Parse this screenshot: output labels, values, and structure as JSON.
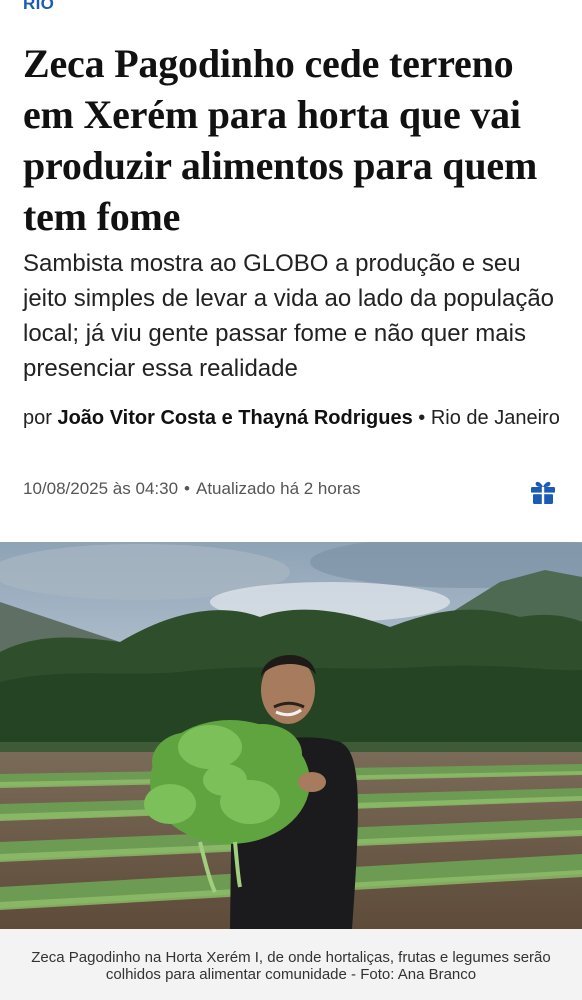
{
  "section_label": "RIO",
  "headline": "Zeca Pagodinho cede terreno em Xerém para horta que vai produzir alimentos para quem tem fome",
  "subtitle": "Sambista mostra ao GLOBO a produção e seu jeito simples de levar a vida ao lado da população local; já viu gente passar fome e não quer mais presenciar essa realidade",
  "byline": {
    "prefix": "por",
    "authors": "João Vitor Costa e Thayná Rodrigues",
    "location": "• Rio de Janeiro"
  },
  "meta": {
    "published": "10/08/2025 às 04:30",
    "separator": "•",
    "updated_label": "Atualizado",
    "updated_value": "há 2 horas"
  },
  "icons": {
    "gift": "gift-icon"
  },
  "colors": {
    "accent": "#1c5bb5"
  },
  "photo": {
    "caption": "Zeca Pagodinho na Horta Xerém I, de onde hortaliças, frutas e legumes serão colhidos para alimentar comunidade - Foto: Ana Branco"
  }
}
